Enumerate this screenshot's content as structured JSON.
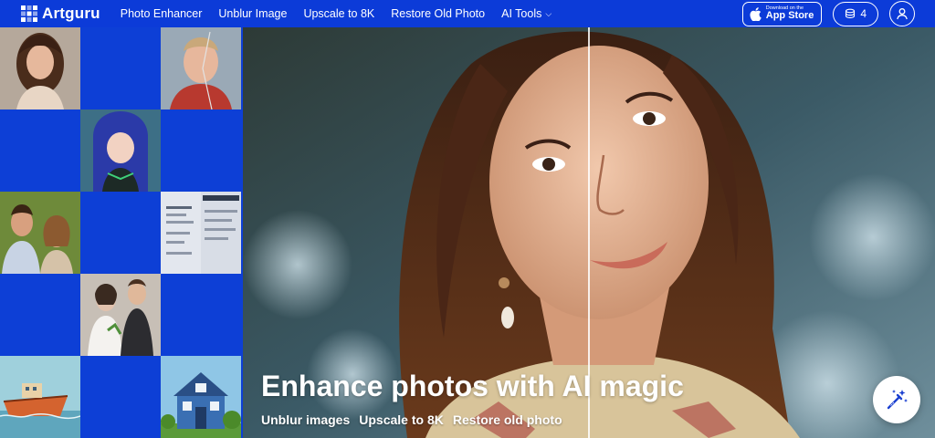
{
  "brand": {
    "name": "Artguru"
  },
  "nav": {
    "links": [
      "Photo Enhancer",
      "Unblur Image",
      "Upscale to 8K",
      "Restore Old Photo",
      "AI Tools"
    ],
    "ai_tools_chevron": "chevron-down-icon"
  },
  "appstore": {
    "small": "Download on the",
    "big": "App Store"
  },
  "credits": {
    "count": "4",
    "icon": "coins-icon"
  },
  "user": {
    "icon": "user-icon"
  },
  "hero": {
    "headline": "Enhance photos with AI magic",
    "links": [
      "Unblur images",
      "Upscale to 8K",
      "Restore old photo"
    ],
    "magic_icon": "magic-wand-icon"
  },
  "grid_tiles": [
    "portrait-woman",
    "old-photo-boy",
    "anime-girl",
    "couple-photo",
    "product-brochure",
    "wedding-photo",
    "boat-illustration",
    "blue-house"
  ],
  "colors": {
    "brand_blue": "#0c3bd8",
    "white": "#ffffff"
  }
}
